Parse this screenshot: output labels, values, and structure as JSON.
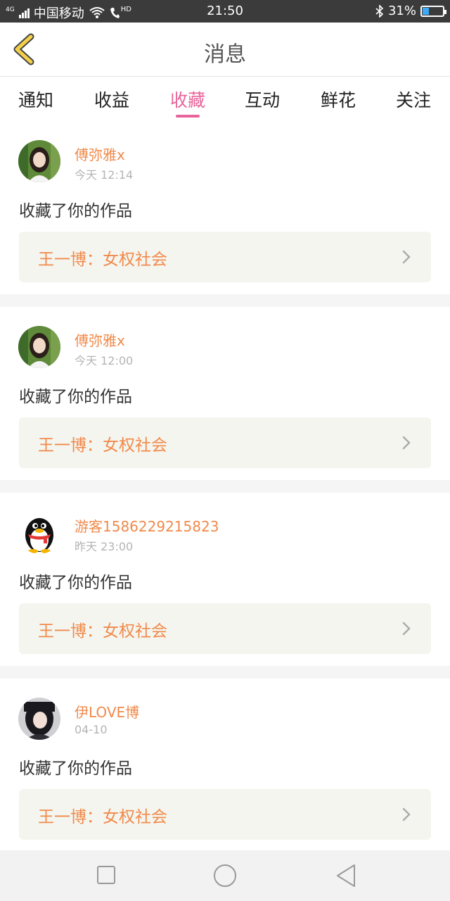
{
  "status_bar": {
    "network_badge": "4G",
    "carrier": "中国移动",
    "hd_badge": "HD",
    "time": "21:50",
    "battery": "31%",
    "battery_level": 0.31
  },
  "header": {
    "back_icon": "chevron-left-icon",
    "title": "消息"
  },
  "tabs": [
    {
      "label": "通知",
      "active": false
    },
    {
      "label": "收益",
      "active": false
    },
    {
      "label": "收藏",
      "active": true
    },
    {
      "label": "互动",
      "active": false
    },
    {
      "label": "鲜花",
      "active": false
    },
    {
      "label": "关注",
      "active": false
    }
  ],
  "colors": {
    "accent_pink": "#e8649a",
    "name_orange": "#f08a4b",
    "card_bg": "#f5f5ef"
  },
  "messages": [
    {
      "user": "傅弥雅x",
      "time": "今天 12:14",
      "action": "收藏了你的作品",
      "work": "王一博：女权社会",
      "avatar_icon": "girl-photo-avatar"
    },
    {
      "user": "傅弥雅x",
      "time": "今天 12:00",
      "action": "收藏了你的作品",
      "work": "王一博：女权社会",
      "avatar_icon": "girl-photo-avatar"
    },
    {
      "user": "游客1586229215823",
      "time": "昨天 23:00",
      "action": "收藏了你的作品",
      "work": "王一博：女权社会",
      "avatar_icon": "penguin-avatar"
    },
    {
      "user": "伊LOVE博",
      "time": "04-10",
      "action": "收藏了你的作品",
      "work": "王一博：女权社会",
      "avatar_icon": "dark-hair-photo-avatar"
    }
  ],
  "nav_bar": {
    "items": [
      "recent-apps-icon",
      "home-icon",
      "back-triangle-icon"
    ]
  }
}
